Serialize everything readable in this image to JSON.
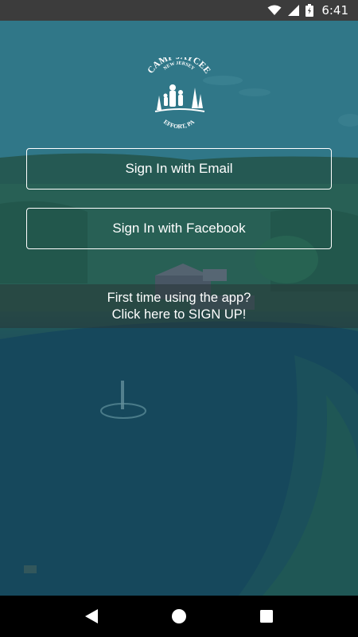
{
  "status_bar": {
    "time": "6:41",
    "icons": [
      "wifi-icon",
      "signal-icon",
      "battery-icon"
    ]
  },
  "logo": {
    "top_text": "NEW JERSEY",
    "name": "CAMP JAYCEE",
    "bottom_text": "EFFORT, PA"
  },
  "buttons": {
    "email": "Sign In with Email",
    "facebook": "Sign In with Facebook"
  },
  "signup": {
    "line1": "First time using the app?",
    "line2": "Click here to SIGN UP!"
  },
  "nav": {
    "icons": [
      "back-icon",
      "home-icon",
      "recents-icon"
    ]
  },
  "colors": {
    "overlay": "#2a6c7c",
    "button_border": "#ffffff",
    "text": "#ffffff",
    "status_bar": "#3c3c3c",
    "nav_bar": "#000000"
  }
}
